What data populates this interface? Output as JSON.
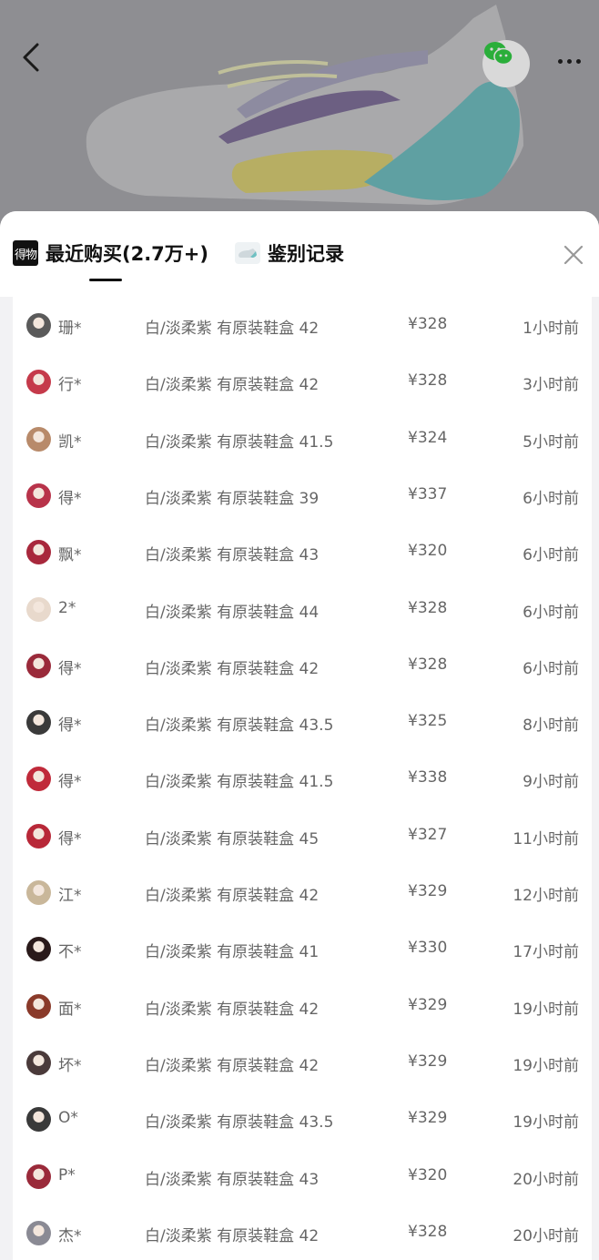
{
  "header": {
    "back_icon": "chevron-left-icon",
    "share_icon": "wechat-icon",
    "more_icon": "more-dots-icon"
  },
  "tabs": {
    "recent": {
      "label": "最近购买(2.7万+)",
      "logo_text": "得物"
    },
    "auth": {
      "label": "鉴别记录"
    },
    "close_icon": "close-icon"
  },
  "purchases": [
    {
      "name": "珊*",
      "desc": "白/淡柔紫 有原装鞋盒 42",
      "price": "¥328",
      "time": "1小时前",
      "avatar_color": "#5a5a5a"
    },
    {
      "name": "行*",
      "desc": "白/淡柔紫 有原装鞋盒 42",
      "price": "¥328",
      "time": "3小时前",
      "avatar_color": "#c53a4a"
    },
    {
      "name": "凯*",
      "desc": "白/淡柔紫 有原装鞋盒 41.5",
      "price": "¥324",
      "time": "5小时前",
      "avatar_color": "#b88a6a"
    },
    {
      "name": "得*",
      "desc": "白/淡柔紫 有原装鞋盒 39",
      "price": "¥337",
      "time": "6小时前",
      "avatar_color": "#b8334a"
    },
    {
      "name": "飘*",
      "desc": "白/淡柔紫 有原装鞋盒 43",
      "price": "¥320",
      "time": "6小时前",
      "avatar_color": "#a8283c"
    },
    {
      "name": "2*",
      "desc": "白/淡柔紫 有原装鞋盒 44",
      "price": "¥328",
      "time": "6小时前",
      "avatar_color": "#e8d9cc"
    },
    {
      "name": "得*",
      "desc": "白/淡柔紫 有原装鞋盒 42",
      "price": "¥328",
      "time": "6小时前",
      "avatar_color": "#9a2a3a"
    },
    {
      "name": "得*",
      "desc": "白/淡柔紫 有原装鞋盒 43.5",
      "price": "¥325",
      "time": "8小时前",
      "avatar_color": "#3a3a3a"
    },
    {
      "name": "得*",
      "desc": "白/淡柔紫 有原装鞋盒 41.5",
      "price": "¥338",
      "time": "9小时前",
      "avatar_color": "#c02a3a"
    },
    {
      "name": "得*",
      "desc": "白/淡柔紫 有原装鞋盒 45",
      "price": "¥327",
      "time": "11小时前",
      "avatar_color": "#b82838"
    },
    {
      "name": "江*",
      "desc": "白/淡柔紫 有原装鞋盒 42",
      "price": "¥329",
      "time": "12小时前",
      "avatar_color": "#c9b79a"
    },
    {
      "name": "不*",
      "desc": "白/淡柔紫 有原装鞋盒 41",
      "price": "¥330",
      "time": "17小时前",
      "avatar_color": "#2a1a1a"
    },
    {
      "name": "面*",
      "desc": "白/淡柔紫 有原装鞋盒 42",
      "price": "¥329",
      "time": "19小时前",
      "avatar_color": "#8a3a2a"
    },
    {
      "name": "坏*",
      "desc": "白/淡柔紫 有原装鞋盒 42",
      "price": "¥329",
      "time": "19小时前",
      "avatar_color": "#4a3a3a"
    },
    {
      "name": "O*",
      "desc": "白/淡柔紫 有原装鞋盒 43.5",
      "price": "¥329",
      "time": "19小时前",
      "avatar_color": "#3a3a3a"
    },
    {
      "name": "P*",
      "desc": "白/淡柔紫 有原装鞋盒 43",
      "price": "¥320",
      "time": "20小时前",
      "avatar_color": "#9a2a3a"
    },
    {
      "name": "杰*",
      "desc": "白/淡柔紫 有原装鞋盒 42",
      "price": "¥328",
      "time": "20小时前",
      "avatar_color": "#8a8a94"
    }
  ]
}
